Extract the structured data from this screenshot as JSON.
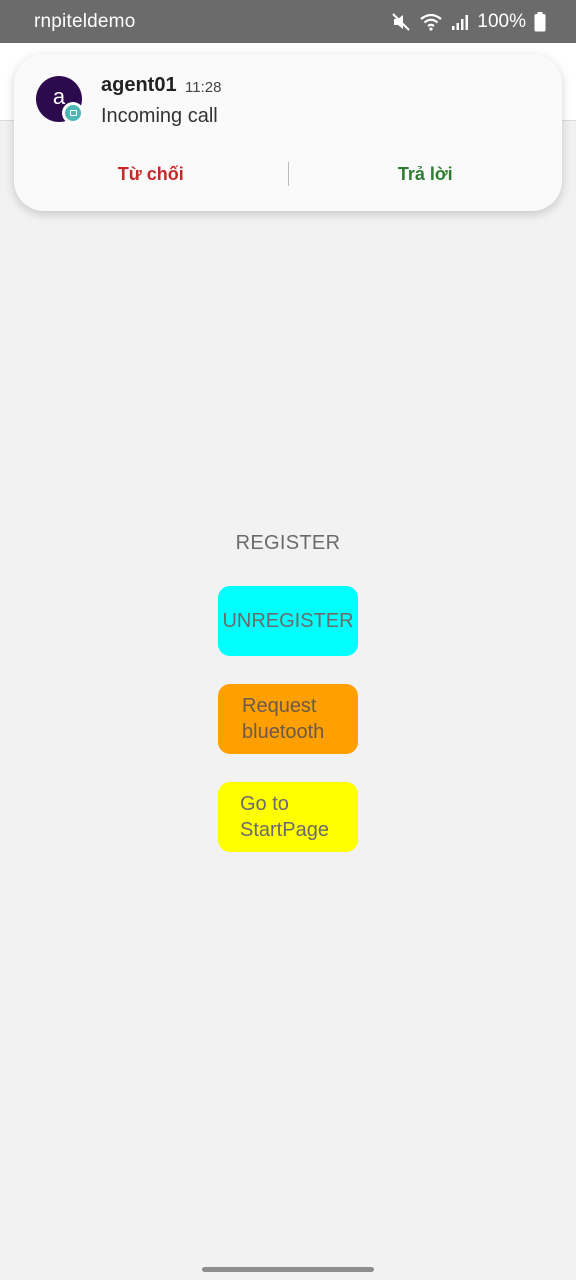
{
  "status_bar": {
    "app_name": "rnpiteldemo",
    "battery": "100%",
    "icons": [
      "mute-icon",
      "wifi-icon",
      "signal-icon",
      "battery-icon"
    ]
  },
  "notification": {
    "avatar_letter": "a",
    "title": "agent01",
    "time": "11:28",
    "body": "Incoming call",
    "actions": {
      "decline": "Từ chối",
      "accept": "Trả lời"
    }
  },
  "main": {
    "register_label": "REGISTER",
    "unregister_button": "UNREGISTER",
    "bluetooth_button": "Request bluetooth",
    "startpage_button": "Go to StartPage"
  },
  "colors": {
    "unregister": "#00ffff",
    "bluetooth": "#ffa000",
    "startpage": "#ffff00",
    "decline": "#c62828",
    "accept": "#2e7d32",
    "avatar": "#2d0a4e"
  }
}
